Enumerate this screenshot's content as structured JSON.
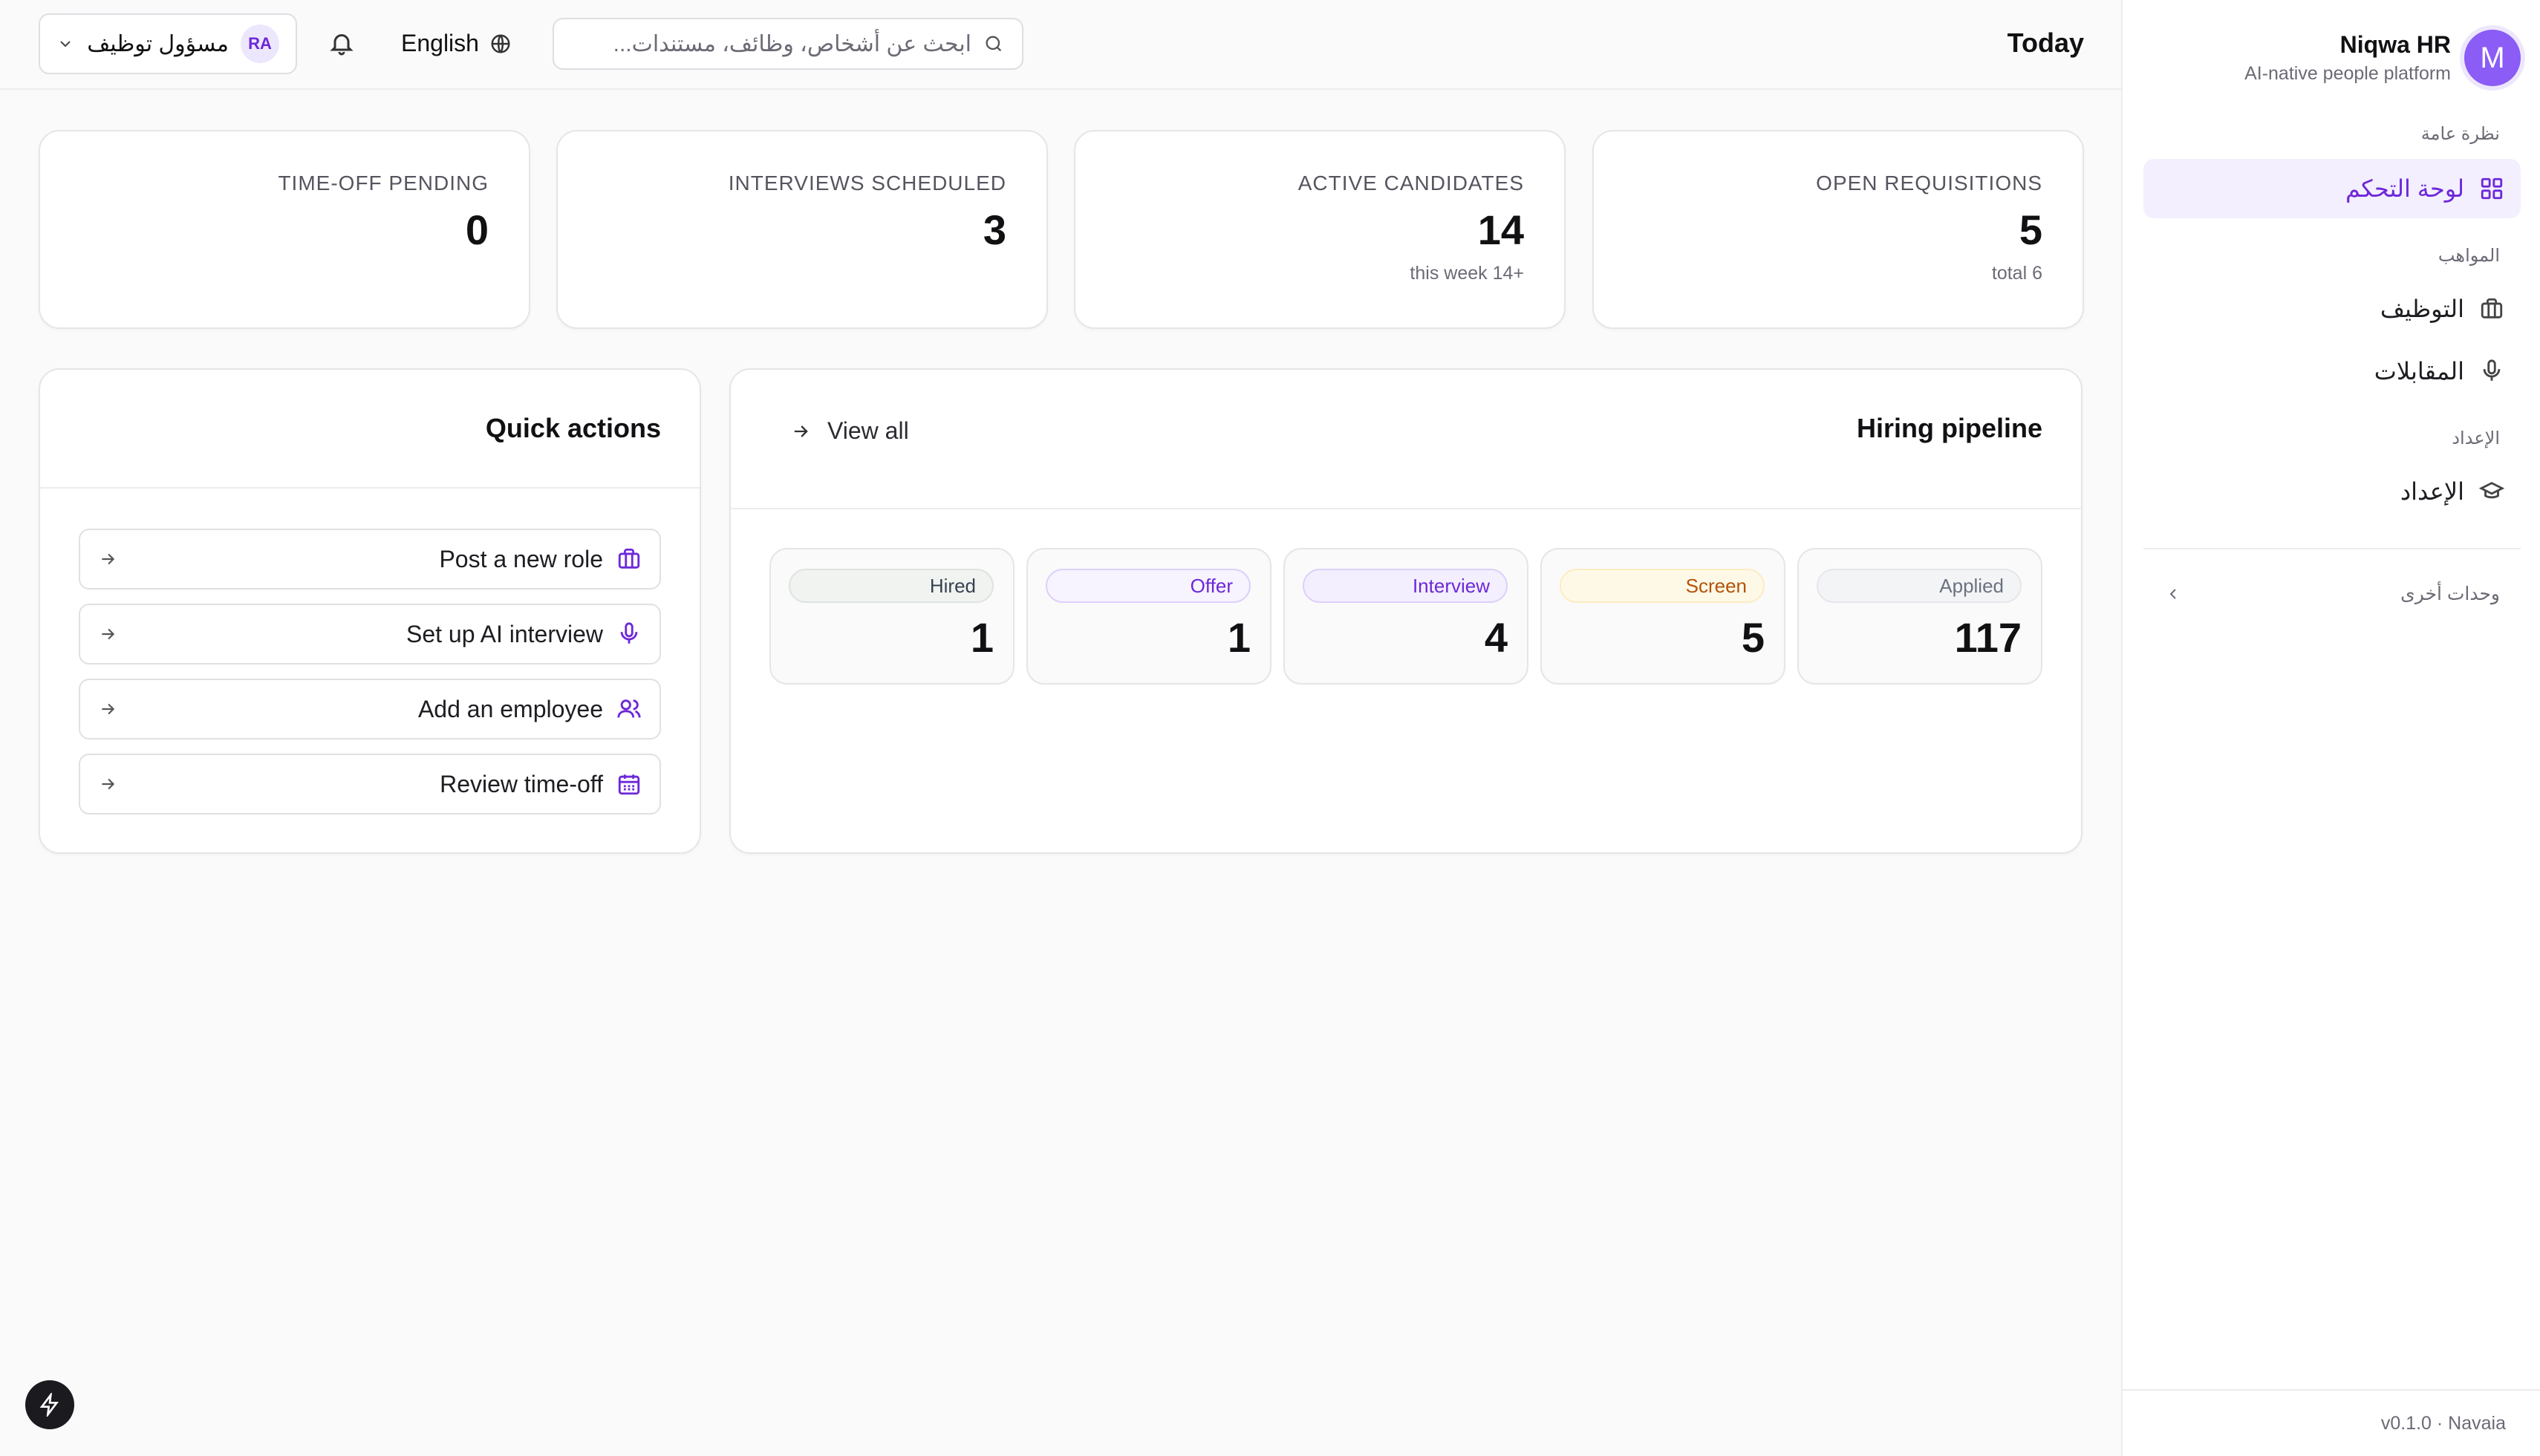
{
  "brand": {
    "avatar_letter": "M",
    "name": "Niqwa HR",
    "tagline": "AI-native people platform"
  },
  "sidebar": {
    "sections": [
      {
        "label": "نظرة عامة"
      },
      {
        "label": "المواهب"
      },
      {
        "label": "الإعداد"
      }
    ],
    "items": [
      {
        "label": "لوحة التحكم",
        "icon": "grid-icon",
        "active": true
      },
      {
        "label": "التوظيف",
        "icon": "briefcase-icon"
      },
      {
        "label": "المقابلات",
        "icon": "mic-icon"
      },
      {
        "label": "الإعداد",
        "icon": "graduation-cap-icon"
      }
    ],
    "other_modules": "وحدات أخرى",
    "footer": "v0.1.0 · Navaia"
  },
  "topbar": {
    "title": "Today",
    "search_placeholder": "ابحث عن أشخاص، وظائف، مستندات...",
    "language": "English",
    "user_initials": "RA",
    "user_role": "مسؤول توظيف"
  },
  "stats": [
    {
      "label": "OPEN REQUISITIONS",
      "value": "5",
      "sub": "total 6"
    },
    {
      "label": "ACTIVE CANDIDATES",
      "value": "14",
      "sub": "this week 14+"
    },
    {
      "label": "INTERVIEWS SCHEDULED",
      "value": "3",
      "sub": ""
    },
    {
      "label": "TIME-OFF PENDING",
      "value": "0",
      "sub": ""
    }
  ],
  "pipeline": {
    "title": "Hiring pipeline",
    "view_all": "View all",
    "stages": [
      {
        "label": "Applied",
        "value": "117",
        "color": "#6b7280",
        "bg": "#f3f4f6",
        "border": "#e5e7eb"
      },
      {
        "label": "Screen",
        "value": "5",
        "color": "#b45309",
        "bg": "#fef9e7",
        "border": "#fcecc2"
      },
      {
        "label": "Interview",
        "value": "4",
        "color": "#6d28d9",
        "bg": "#f3effe",
        "border": "#ddd0fb"
      },
      {
        "label": "Offer",
        "value": "1",
        "color": "#6d28d9",
        "bg": "#f7f3ff",
        "border": "#ddd0fb"
      },
      {
        "label": "Hired",
        "value": "1",
        "color": "#374151",
        "bg": "#f1f3f1",
        "border": "#dfe3df"
      }
    ]
  },
  "quick_actions": {
    "title": "Quick actions",
    "items": [
      {
        "label": "Post a new role",
        "icon": "briefcase-icon"
      },
      {
        "label": "Set up AI interview",
        "icon": "mic-icon"
      },
      {
        "label": "Add an employee",
        "icon": "users-icon"
      },
      {
        "label": "Review time-off",
        "icon": "calendar-icon"
      }
    ]
  },
  "colors": {
    "accent": "#6d28d9",
    "accent_soft": "#f3effe",
    "brand": "#8b5cf6"
  }
}
